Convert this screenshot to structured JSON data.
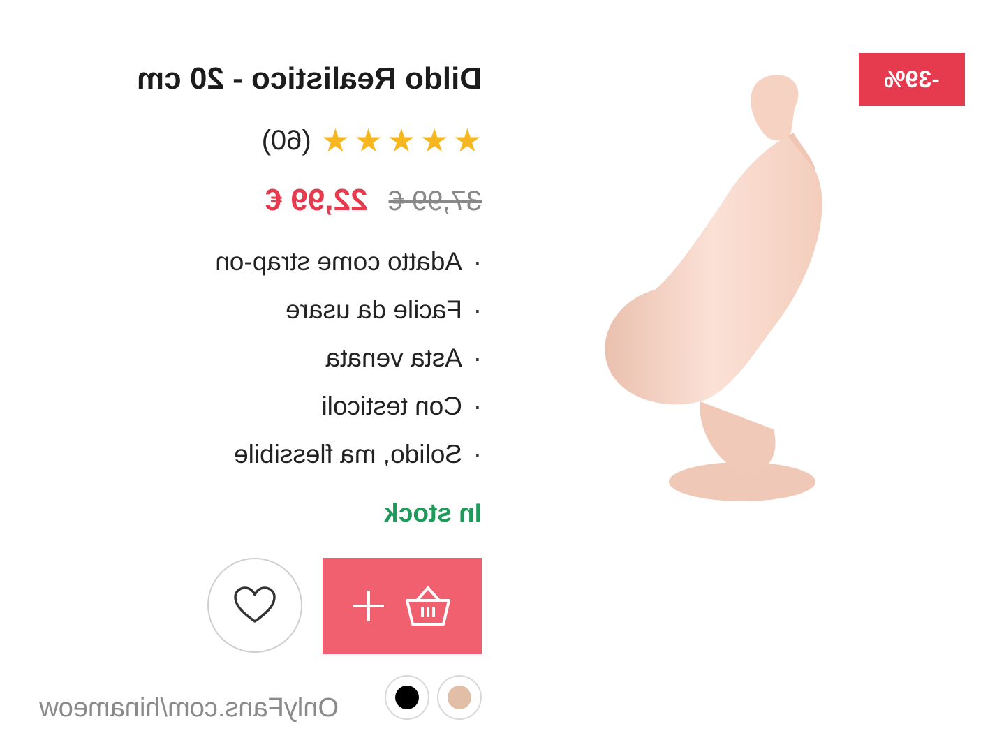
{
  "product": {
    "title": "Dildo Realistico - 20 cm",
    "discount_badge": "-39%",
    "rating": {
      "stars": 5,
      "max_stars": 5,
      "count_label": "(60)"
    },
    "price": {
      "old": "37,99 €",
      "new": "22,99 €"
    },
    "features": [
      {
        "label": "Adatto come strap-on"
      },
      {
        "label": "Facile da usare"
      },
      {
        "label": "Asta venata"
      },
      {
        "label": "Con testicoli"
      },
      {
        "label": "Solido, ma flessibile"
      }
    ],
    "bullet": "·",
    "stock_status": "In stock",
    "color_options": [
      {
        "name": "black",
        "hex": "#000000"
      },
      {
        "name": "beige",
        "hex": "#e3bea6"
      }
    ]
  },
  "actions": {
    "add_to_cart_icon": "basket-plus-icon",
    "wishlist_icon": "heart-icon"
  },
  "watermark": "OnlyFans.com/hinameow",
  "colors": {
    "accent_red": "#e63a4e",
    "cart_pink": "#f1606f",
    "stock_green": "#1f9a5b",
    "star_yellow": "#f6b620",
    "product_skin": "#f6d5c6"
  }
}
